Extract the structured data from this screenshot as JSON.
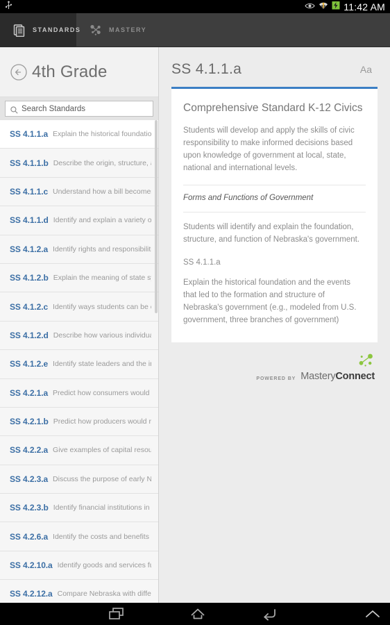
{
  "status_bar": {
    "usb_icon": "usb-icon",
    "icons": [
      "eye-icon",
      "wifi-icon",
      "battery-icon"
    ],
    "clock": "11:42 AM"
  },
  "tabs": [
    {
      "id": "standards",
      "label": "STANDARDS",
      "icon": "documents-icon",
      "active": true
    },
    {
      "id": "mastery",
      "label": "MASTERY",
      "icon": "network-nodes-icon",
      "active": false
    }
  ],
  "sidebar": {
    "back_icon": "back-circle-arrow-icon",
    "title": "4th Grade",
    "search": {
      "icon": "search-icon",
      "placeholder": "Search Standards",
      "value": ""
    },
    "standards": [
      {
        "code": "SS 4.1.1.a",
        "desc": "Explain the historical foundation...",
        "selected": true
      },
      {
        "code": "SS 4.1.1.b",
        "desc": "Describe the origin, structure, an...",
        "selected": false
      },
      {
        "code": "SS 4.1.1.c",
        "desc": "Understand how a bill becomes...",
        "selected": false
      },
      {
        "code": "SS 4.1.1.d",
        "desc": "Identify and explain a variety of r...",
        "selected": false
      },
      {
        "code": "SS 4.1.2.a",
        "desc": "Identify rights and responsibilitie...",
        "selected": false
      },
      {
        "code": "SS 4.1.2.b",
        "desc": "Explain the meaning of state sym...",
        "selected": false
      },
      {
        "code": "SS 4.1.2.c",
        "desc": "Identify ways students can be en...",
        "selected": false
      },
      {
        "code": "SS 4.1.2.d",
        "desc": "Describe how various individual...",
        "selected": false
      },
      {
        "code": "SS 4.1.2.e",
        "desc": "Identify state leaders and the im...",
        "selected": false
      },
      {
        "code": "SS 4.2.1.a",
        "desc": "Predict how consumers would re...",
        "selected": false
      },
      {
        "code": "SS 4.2.1.b",
        "desc": "Predict how producers would re...",
        "selected": false
      },
      {
        "code": "SS 4.2.2.a",
        "desc": "Give examples of capital resourc...",
        "selected": false
      },
      {
        "code": "SS 4.2.3.a",
        "desc": "Discuss the purpose of early NE...",
        "selected": false
      },
      {
        "code": "SS 4.2.3.b",
        "desc": "Identify financial institutions in t...",
        "selected": false
      },
      {
        "code": "SS 4.2.6.a",
        "desc": "Identify the costs and benefits of...",
        "selected": false
      },
      {
        "code": "SS 4.2.10.a",
        "desc": "Identify goods and services fun...",
        "selected": false
      },
      {
        "code": "SS 4.2.12.a",
        "desc": "Compare Nebraska with differe...",
        "selected": false
      }
    ]
  },
  "detail": {
    "title": "SS 4.1.1.a",
    "font_size_button": "Aa",
    "card": {
      "heading": "Comprehensive Standard K-12 Civics",
      "description": "Students will develop and apply the skills of civic responsibility to make informed decisions based upon knowledge of government at local, state, national and international levels.",
      "subsection_title": "Forms and Functions of Government",
      "subsection_description": "Students will identify and explain the foundation, structure, and function of Nebraska's government.",
      "standard_code": "SS 4.1.1.a",
      "standard_text": "Explain the historical foundation and the events that led to the formation and structure of Nebraska's government (e.g., modeled from U.S. government, three branches of government)"
    },
    "branding": {
      "powered_by": "POWERED BY",
      "name_light": "Mastery",
      "name_bold": "Connect",
      "dots_icon": "masteryconnect-dots-icon",
      "dot_color": "#8cc63f"
    }
  },
  "nav_bar": {
    "buttons": [
      {
        "id": "recent",
        "icon": "recent-apps-icon"
      },
      {
        "id": "home",
        "icon": "home-icon"
      },
      {
        "id": "back",
        "icon": "back-icon"
      },
      {
        "id": "expand",
        "icon": "chevron-up-icon"
      }
    ]
  },
  "colors": {
    "accent_blue": "#3c7fc4",
    "code_blue": "#3c6fa5",
    "brand_green": "#8cc63f",
    "tab_bar": "#3e3e3e",
    "tab_active": "#2b2b2b"
  }
}
